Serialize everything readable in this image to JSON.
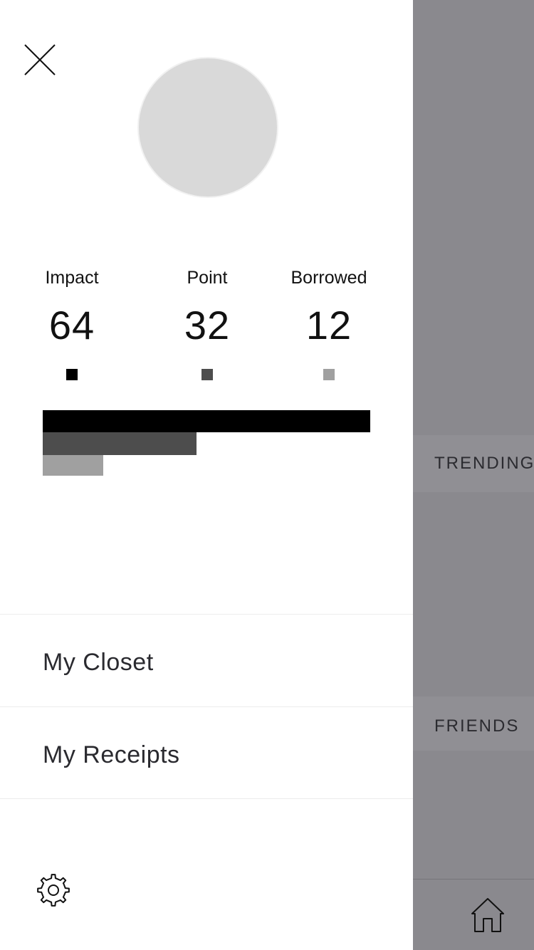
{
  "background": {
    "sections": {
      "trending": "TRENDING",
      "friends": "FRIENDS"
    },
    "tabbar": {
      "home_icon": "home-icon"
    }
  },
  "drawer": {
    "close_icon": "close-icon",
    "avatar": "avatar-placeholder",
    "stats": [
      {
        "label": "Impact",
        "value": "64",
        "color": "#000000"
      },
      {
        "label": "Point",
        "value": "32",
        "color": "#4d4d4d"
      },
      {
        "label": "Borrowed",
        "value": "12",
        "color": "#a0a0a0"
      }
    ],
    "menu": [
      {
        "label": "My Closet"
      },
      {
        "label": "My Receipts"
      }
    ],
    "settings_icon": "gear-icon"
  },
  "chart_data": {
    "type": "bar",
    "categories": [
      "Impact",
      "Point",
      "Borrowed"
    ],
    "values": [
      64,
      32,
      12
    ],
    "colors": [
      "#000000",
      "#4d4d4d",
      "#a0a0a0"
    ],
    "orientation": "horizontal",
    "xlim": [
      0,
      64
    ]
  }
}
